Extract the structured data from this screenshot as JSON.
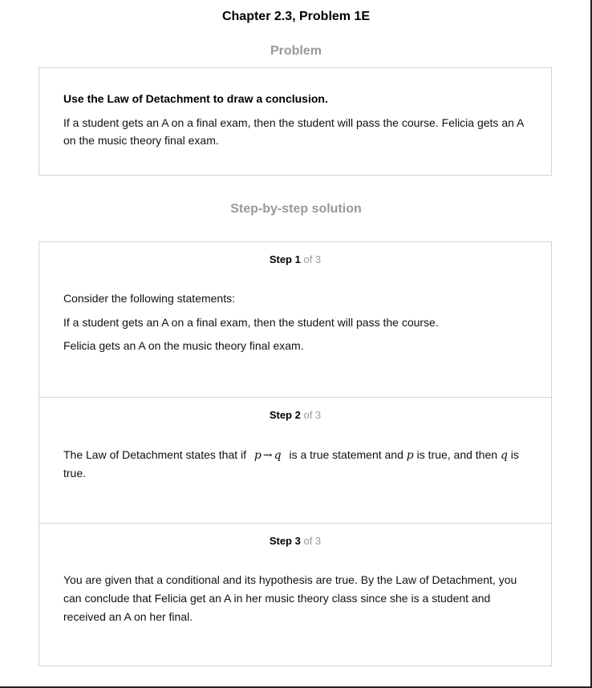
{
  "page": {
    "chapter_title": "Chapter 2.3, Problem 1E"
  },
  "problem": {
    "heading": "Problem",
    "instruction": "Use the Law of Detachment to draw a conclusion.",
    "text": "If a student gets an A on a final exam, then the student will pass the course. Felicia gets an A on the music theory final exam."
  },
  "solution": {
    "heading": "Step-by-step solution",
    "steps": [
      {
        "label": "Step 1",
        "of_text": "of 3",
        "paragraphs": [
          "Consider the following statements:",
          "If a student gets an A on a final exam, then the student will pass the course.",
          "Felicia gets an A on the music theory final exam."
        ]
      },
      {
        "label": "Step 2",
        "of_text": "of 3",
        "text_before": "The Law of Detachment states that if",
        "formula_p": "p",
        "formula_arrow": "→",
        "formula_q": "q",
        "text_middle": "is a true statement and",
        "var_p": "p",
        "text_middle2": "is true, and then",
        "var_q": "q",
        "text_after": "is true."
      },
      {
        "label": "Step 3",
        "of_text": "of 3",
        "text": "You are given that a conditional and its hypothesis are true. By the Law of Detachment, you can conclude that Felicia get an A in her music theory class since she is a student and received an A on her final."
      }
    ]
  }
}
